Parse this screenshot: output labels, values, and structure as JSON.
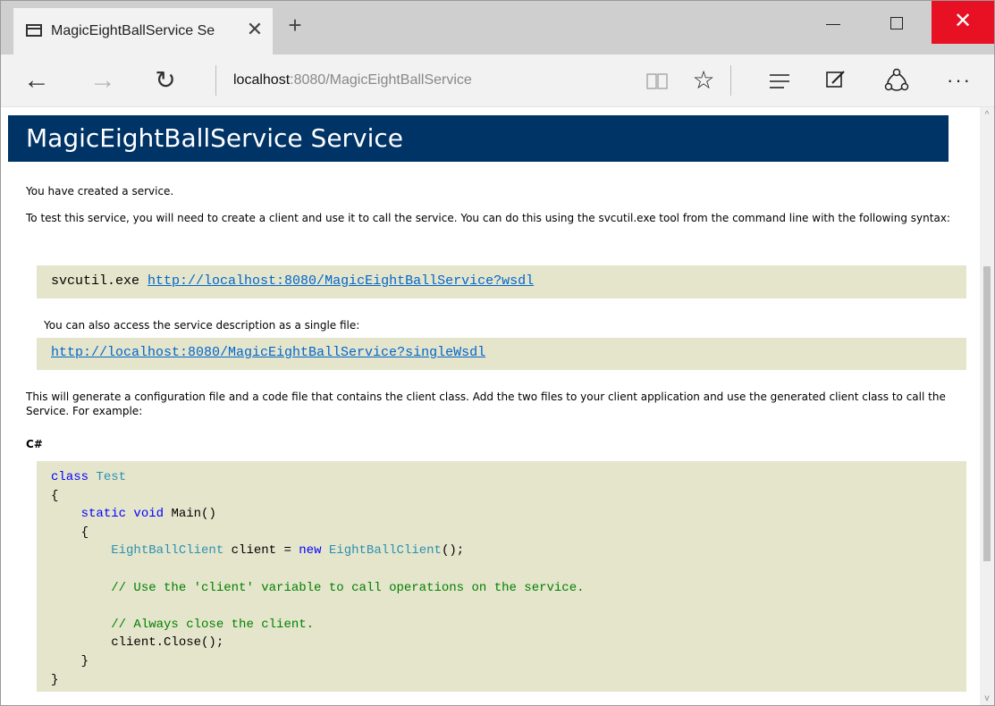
{
  "browser": {
    "tab_title": "MagicEightBallService Se",
    "tab_close": "✕",
    "new_tab": "+",
    "window": {
      "minimize": "",
      "maximize": "",
      "close": "✕"
    },
    "address": {
      "host": "localhost",
      "rest": ":8080/MagicEightBallService"
    },
    "toolbar": {
      "back": "←",
      "forward": "→",
      "refresh": "↻",
      "favorite": "☆",
      "more": "···"
    }
  },
  "page": {
    "heading": "MagicEightBallService Service",
    "p1": "You have created a service.",
    "p2": "To test this service, you will need to create a client and use it to call the service. You can do this using the svcutil.exe tool from the command line with the following syntax:",
    "svcutil_cmd": "svcutil.exe ",
    "wsdl_url": "http://localhost:8080/MagicEightBallService?wsdl",
    "p3": "You can also access the service description as a single file:",
    "single_wsdl_url": "http://localhost:8080/MagicEightBallService?singleWsdl",
    "p4": "This will generate a configuration file and a code file that contains the client class. Add the two files to your client application and use the generated client class to call the Service. For example:",
    "lang_label": "C#",
    "code": {
      "l1_kw": "class",
      "l1_type": "Test",
      "l2": "{",
      "l3_kw": "static void",
      "l3_rest": "Main()",
      "l4": "{",
      "l5_type": "EightBallClient",
      "l5_mid": "client =",
      "l5_kw": "new",
      "l5_type2": "EightBallClient",
      "l5_end": "();",
      "l6_comment": "// Use the 'client' variable to call operations on the service.",
      "l7_comment": "// Always close the client.",
      "l8": "client.Close();",
      "l9": "}",
      "l10": "}"
    }
  },
  "scrollbar": {
    "up": "^",
    "down": "v"
  }
}
